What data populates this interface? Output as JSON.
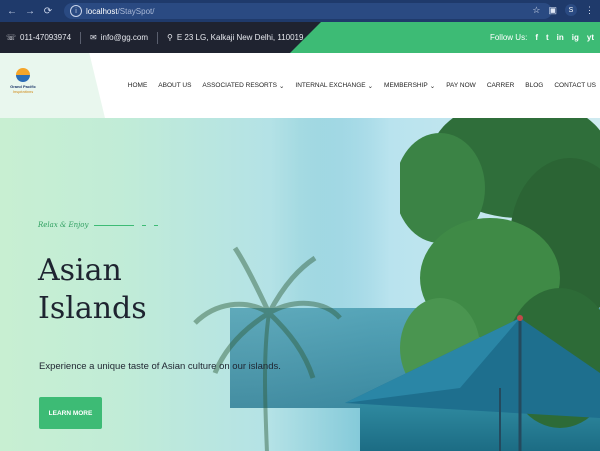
{
  "browser": {
    "url_host": "localhost",
    "url_path": "/StaySpot/",
    "profile_initial": "S"
  },
  "topbar": {
    "phone": "011-47093974",
    "email": "info@gg.com",
    "address": "E 23 LG, Kalkaji New Delhi, 110019",
    "follow_label": "Follow Us:",
    "social": [
      "f",
      "t",
      "in",
      "ig",
      "yt"
    ]
  },
  "logo": {
    "name": "Grand Pacific",
    "tagline": "Inspirations"
  },
  "menu": {
    "items": [
      {
        "label": "HOME",
        "dropdown": false
      },
      {
        "label": "ABOUT US",
        "dropdown": false
      },
      {
        "label": "ASSOCIATED RESORTS",
        "dropdown": true
      },
      {
        "label": "INTERNAL EXCHANGE",
        "dropdown": true
      },
      {
        "label": "MEMBERSHIP",
        "dropdown": true
      },
      {
        "label": "PAY NOW",
        "dropdown": false
      },
      {
        "label": "CARRER",
        "dropdown": false
      },
      {
        "label": "BLOG",
        "dropdown": false
      },
      {
        "label": "CONTACT US",
        "dropdown": false
      }
    ]
  },
  "hero": {
    "kicker": "Relax & Enjoy",
    "title_line1": "Asian",
    "title_line2": "Islands",
    "subtitle": "Experience a unique taste of Asian culture on our islands.",
    "button_label": "LEARN MORE"
  },
  "colors": {
    "accent": "#3dbb75",
    "dark": "#1f2330",
    "chrome": "#1f3a6b"
  }
}
